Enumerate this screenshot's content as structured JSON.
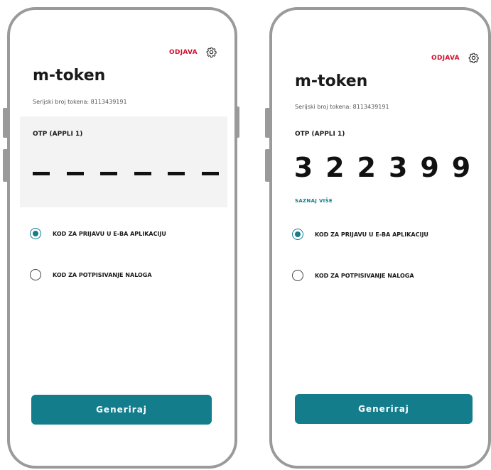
{
  "app": {
    "title": "m-token",
    "logout_label": "ODJAVA",
    "settings_icon": "gear-icon",
    "serial_text": "Serijski broj tokena: 8113439191",
    "otp_label": "OTP (APPLI 1)",
    "learn_more_label": "SAZNAJ VIŠE",
    "options": [
      {
        "label": "KOD ZA PRIJAVU U E-BA APLIKACIJU"
      },
      {
        "label": "KOD ZA POTPISIVANJE NALOGA"
      }
    ],
    "generate_label": "Generiraj"
  },
  "screens": [
    {
      "state": "empty",
      "placeholder": "— — — — — —",
      "selected_option": 0
    },
    {
      "state": "generated",
      "otp_digits": [
        "3",
        "2",
        "2",
        "3",
        "9",
        "9"
      ],
      "selected_option": 0
    }
  ],
  "colors": {
    "accent": "#137d8c",
    "logout": "#d0102a",
    "panel_bg": "#f3f3f3",
    "frame": "#9a9a9a"
  }
}
